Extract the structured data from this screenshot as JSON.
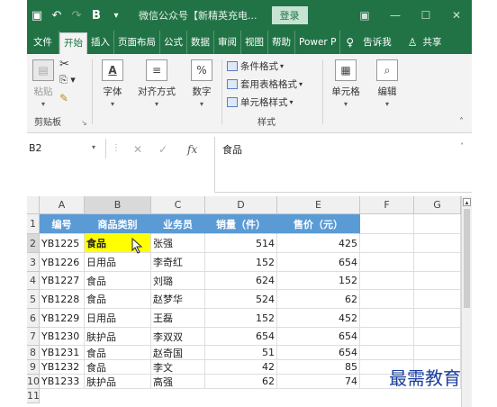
{
  "titlebar": {
    "save_icon": "save-icon",
    "undo_icon": "undo-icon",
    "bold_label": "B",
    "title": "微信公众号【新精英充电...",
    "login": "登录",
    "ribbon_display_icon": "ribbon-display-icon",
    "minimize": "—",
    "restore": "☐",
    "close": "✕"
  },
  "tabs": [
    "文件",
    "开始",
    "插入",
    "页面布局",
    "公式",
    "数据",
    "审阅",
    "视图",
    "帮助",
    "Power P"
  ],
  "tell_me": "告诉我",
  "share": "共享",
  "ribbon": {
    "paste": "粘贴",
    "clipboard": "剪贴板",
    "font": "字体",
    "alignment": "对齐方式",
    "number": "数字",
    "conditional_format": "条件格式",
    "table_format": "套用表格格式",
    "cell_style": "单元格样式",
    "styles": "样式",
    "cells": "单元格",
    "editing": "编辑"
  },
  "formula_bar": {
    "name_box": "B2",
    "cancel": "✕",
    "enter": "✓",
    "fx": "fx",
    "content": "食品"
  },
  "grid": {
    "columns": [
      "A",
      "B",
      "C",
      "D",
      "E",
      "F",
      "G"
    ],
    "headers": [
      "编号",
      "商品类别",
      "业务员",
      "销量（件）",
      "售价（元）"
    ],
    "rows": [
      [
        "YB1225",
        "食品",
        "张强",
        "514",
        "425"
      ],
      [
        "YB1226",
        "日用品",
        "李奇红",
        "152",
        "654"
      ],
      [
        "YB1227",
        "食品",
        "刘璐",
        "624",
        "152"
      ],
      [
        "YB1228",
        "食品",
        "赵梦华",
        "524",
        "62"
      ],
      [
        "YB1229",
        "日用品",
        "王磊",
        "152",
        "452"
      ],
      [
        "YB1230",
        "肤护品",
        "李双双",
        "654",
        "654"
      ],
      [
        "YB1231",
        "食品",
        "赵奇国",
        "51",
        "654"
      ],
      [
        "YB1232",
        "食品",
        "李文",
        "42",
        "85"
      ],
      [
        "YB1233",
        "肤护品",
        "高强",
        "62",
        "74"
      ]
    ],
    "row_numbers": [
      "1",
      "2",
      "3",
      "4",
      "5",
      "6",
      "7",
      "8",
      "9",
      "10",
      "11"
    ]
  },
  "selected_cell": "B2",
  "watermark": "最需教育",
  "colors": {
    "excel_green": "#217346",
    "header_blue": "#5b9bd5",
    "highlight_yellow": "#ffff00"
  }
}
